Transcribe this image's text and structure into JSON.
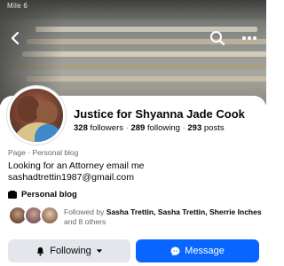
{
  "status_bar": {
    "text": "Mile 6"
  },
  "page": {
    "name": "Justice for Shyanna Jade Cook",
    "stats": {
      "followers_count": "328",
      "followers_label": "followers",
      "following_count": "289",
      "following_label": "following",
      "posts_count": "293",
      "posts_label": "posts",
      "separator": "·"
    },
    "category": "Page · Personal blog",
    "bio": "Looking for an Attorney email me sashadtrettin1987@gmail.com",
    "blog_label": "Personal blog"
  },
  "mutuals": {
    "prefix": "Followed by",
    "name_1": "Sasha Trettin,",
    "name_2": "Sasha Trettin,",
    "name_3": "Sherrie Inches",
    "suffix": "and 8 others"
  },
  "buttons": {
    "following_label": "Following",
    "message_label": "Message"
  },
  "colors": {
    "accent": "#0866ff",
    "secondary_button": "#e4e6eb",
    "muted_text": "#65676b"
  },
  "icons": {
    "back": "back-arrow-icon",
    "search": "search-icon",
    "more": "more-icon",
    "blog": "blog-icon",
    "bell": "bell-icon",
    "chevron": "chevron-down-icon",
    "messenger": "messenger-icon"
  }
}
